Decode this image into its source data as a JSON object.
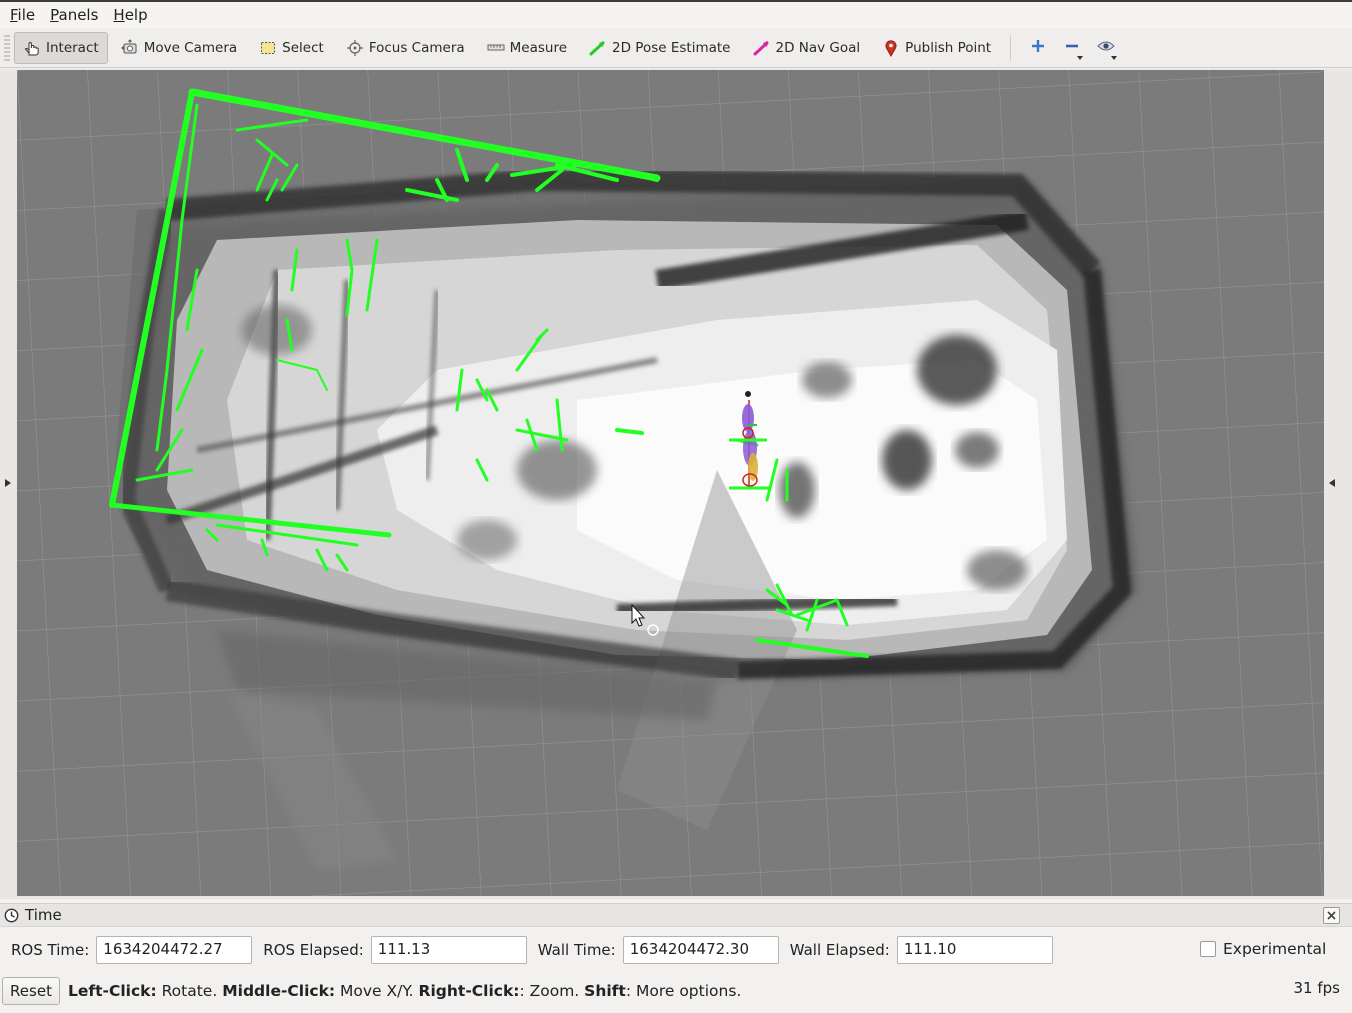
{
  "menu": [
    {
      "mnemonic": "F",
      "rest": "ile"
    },
    {
      "mnemonic": "P",
      "rest": "anels"
    },
    {
      "mnemonic": "H",
      "rest": "elp"
    }
  ],
  "toolbar": {
    "interact": "Interact",
    "move_camera": "Move Camera",
    "select": "Select",
    "focus_camera": "Focus Camera",
    "measure": "Measure",
    "pose_estimate": "2D Pose Estimate",
    "nav_goal": "2D Nav Goal",
    "publish_point": "Publish Point"
  },
  "colors": {
    "pose_estimate": "#22cc22",
    "nav_goal": "#dd22aa",
    "publish_point": "#cc3322",
    "viewport_bg": "#7a7a7a",
    "pointcloud": "#22ff22"
  },
  "time_panel": {
    "title": "Time",
    "ros_time_label": "ROS Time:",
    "ros_time": "1634204472.27",
    "ros_elapsed_label": "ROS Elapsed:",
    "ros_elapsed": "111.13",
    "wall_time_label": "Wall Time:",
    "wall_time": "1634204472.30",
    "wall_elapsed_label": "Wall Elapsed:",
    "wall_elapsed": "111.10",
    "experimental_label": "Experimental"
  },
  "status": {
    "reset_label": "Reset",
    "hint_1_key": "Left-Click:",
    "hint_1_text": " Rotate. ",
    "hint_2_key": "Middle-Click:",
    "hint_2_text": " Move X/Y. ",
    "hint_3_key": "Right-Click:",
    "hint_3_text": ": Zoom. ",
    "hint_4_key": "Shift",
    "hint_4_text": ": More options.",
    "fps": "31 fps"
  }
}
